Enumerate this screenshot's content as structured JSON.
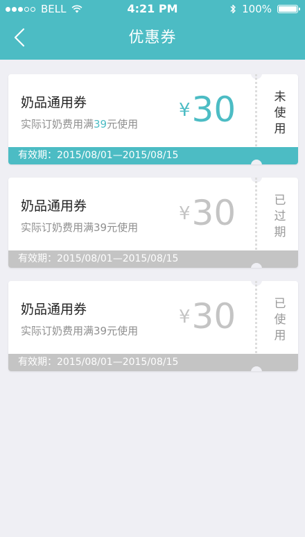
{
  "status_bar": {
    "carrier": "BELL",
    "time": "4:21 PM",
    "battery": "100%"
  },
  "nav": {
    "title": "优惠券"
  },
  "colors": {
    "accent": "#4cbcc4",
    "inactive": "#c4c4c4",
    "page_bg": "#efeff4"
  },
  "icons": {
    "back": "chevron-left-icon",
    "wifi": "wifi-icon",
    "bluetooth": "bluetooth-icon",
    "battery": "battery-icon"
  },
  "coupons": [
    {
      "name": "奶品通用券",
      "condition_prefix": "实际订奶费用满",
      "condition_amount": "39",
      "condition_suffix": "元使用",
      "currency": "¥",
      "amount": "30",
      "status": "未使用",
      "validity": "有效期：2015/08/01—2015/08/15",
      "state": "unused"
    },
    {
      "name": "奶品通用券",
      "condition_prefix": "实际订奶费用满",
      "condition_amount": "39",
      "condition_suffix": "元使用",
      "currency": "¥",
      "amount": "30",
      "status": "已过期",
      "validity": "有效期：2015/08/01—2015/08/15",
      "state": "expired"
    },
    {
      "name": "奶品通用券",
      "condition_prefix": "实际订奶费用满",
      "condition_amount": "39",
      "condition_suffix": "元使用",
      "currency": "¥",
      "amount": "30",
      "status": "已使用",
      "validity": "有效期：2015/08/01—2015/08/15",
      "state": "used"
    }
  ]
}
